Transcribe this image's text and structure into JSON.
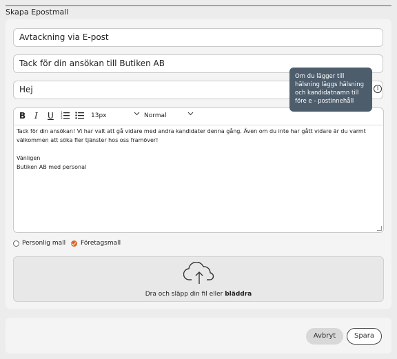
{
  "title": "Skapa Epostmall",
  "fields": {
    "name_value": "Avtackning via E-post",
    "subject_value": "Tack för din ansökan till Butiken AB",
    "greeting_value": "Hej"
  },
  "tooltip": "Om du lägger till hälsning läggs hälsning och kandidatnamn till före e - postinnehåll",
  "toolbar": {
    "bold": "B",
    "italic": "I",
    "underline": "U",
    "font_size": "13px",
    "format": "Normal"
  },
  "body": {
    "paragraph": "Tack för din ansökan! Vi har valt att gå vidare med andra kandidater denna gång. Även om du inte har gått vidare är du varmt välkommen att söka fler tjänster hos oss framöver!",
    "closing": "Vänligen",
    "signature": "Butiken AB med personal"
  },
  "template_type": {
    "personal_label": "Personlig mall",
    "company_label": "Företagsmall",
    "selected": "company"
  },
  "upload": {
    "text": "Dra och släpp din fil eller",
    "link": "bläddra"
  },
  "buttons": {
    "cancel": "Avbryt",
    "save": "Spara"
  },
  "colors": {
    "accent": "#d9672b",
    "tooltip_bg": "#4d5d6c"
  },
  "icons": [
    "info-icon",
    "ordered-list-icon",
    "bullet-list-icon",
    "chevron-down-icon",
    "upload-cloud-icon"
  ]
}
